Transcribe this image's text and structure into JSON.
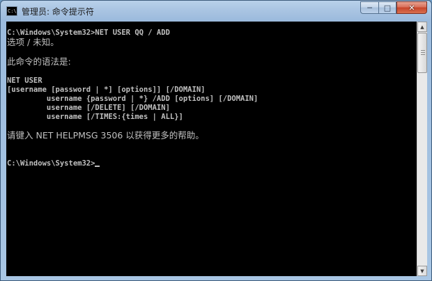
{
  "window": {
    "title": "管理员: 命令提示符",
    "icon_text": "C:\\"
  },
  "caption_buttons": {
    "minimize": "─",
    "maximize": "□",
    "close": "✕"
  },
  "console": {
    "lines": [
      "C:\\Windows\\System32>NET USER QQ / ADD",
      "选项 / 未知。",
      "",
      "此命令的语法是:",
      "",
      "NET USER",
      "[username [password | *] [options]] [/DOMAIN]",
      "         username {password | *} /ADD [options] [/DOMAIN]",
      "         username [/DELETE] [/DOMAIN]",
      "         username [/TIMES:{times | ALL}]",
      "",
      "请键入 NET HELPMSG 3506 以获得更多的帮助。",
      "",
      "",
      "C:\\Windows\\System32>"
    ]
  },
  "colors": {
    "console_bg": "#000000",
    "console_fg": "#c0c0c0",
    "titlebar": "#a9c4e2",
    "close_button": "#c7442a"
  },
  "icons": {
    "app": "cmd-icon",
    "scroll_up": "arrow-up-icon",
    "scroll_down": "arrow-down-icon"
  }
}
